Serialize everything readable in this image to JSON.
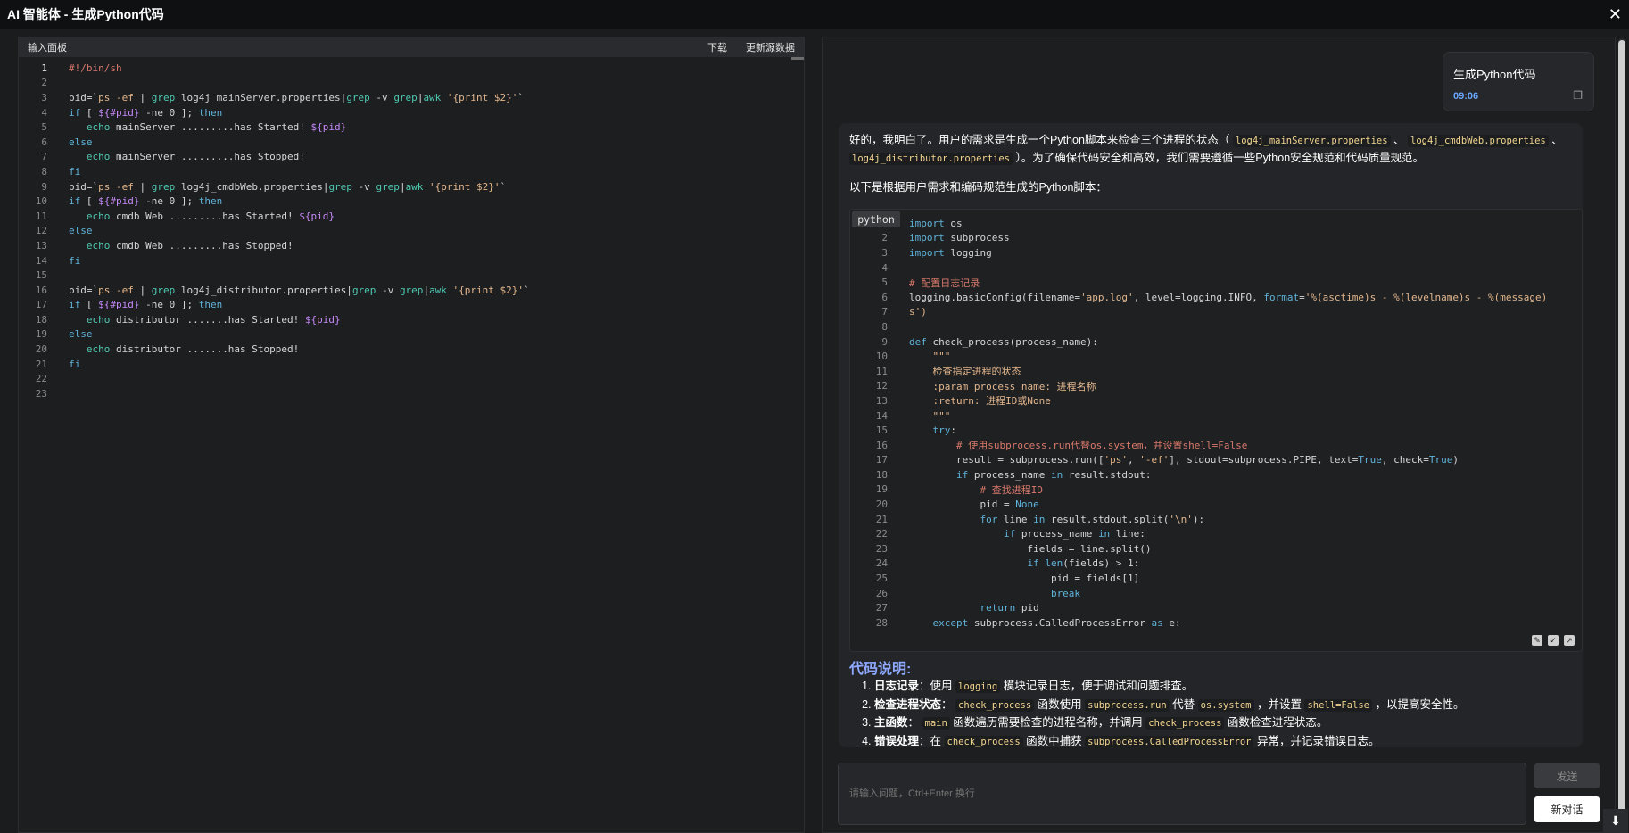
{
  "window": {
    "title": "AI 智能体 - 生成Python代码",
    "close_icon": "close-icon"
  },
  "left_panel": {
    "title": "输入面板",
    "download_label": "下载",
    "refresh_label": "更新源数据"
  },
  "shell_lines": [
    [
      {
        "t": "#!/bin/sh",
        "c": "cm"
      }
    ],
    [],
    [
      {
        "t": "pid=`",
        "c": "fl"
      },
      {
        "t": "ps -ef",
        "c": "str"
      },
      {
        "t": " | ",
        "c": "fl"
      },
      {
        "t": "grep",
        "c": "grn"
      },
      {
        "t": " log4j_mainServer.properties|",
        "c": "fl"
      },
      {
        "t": "grep",
        "c": "grn"
      },
      {
        "t": " -v ",
        "c": "fl"
      },
      {
        "t": "grep",
        "c": "grn"
      },
      {
        "t": "|",
        "c": "fl"
      },
      {
        "t": "awk",
        "c": "grn"
      },
      {
        "t": " '{print $2}'",
        "c": "str"
      },
      {
        "t": "`",
        "c": "fl"
      }
    ],
    [
      {
        "t": "if",
        "c": "kw"
      },
      {
        "t": " [ ",
        "c": "fl"
      },
      {
        "t": "${#pid}",
        "c": "var"
      },
      {
        "t": " -ne 0 ]; ",
        "c": "fl"
      },
      {
        "t": "then",
        "c": "kw"
      }
    ],
    [
      {
        "t": "   echo",
        "c": "grn"
      },
      {
        "t": " mainServer .........has Started! ",
        "c": "fl"
      },
      {
        "t": "${pid}",
        "c": "var"
      }
    ],
    [
      {
        "t": "else",
        "c": "kw"
      }
    ],
    [
      {
        "t": "   echo",
        "c": "grn"
      },
      {
        "t": " mainServer .........has Stopped!",
        "c": "fl"
      }
    ],
    [
      {
        "t": "fi",
        "c": "kw"
      }
    ],
    [
      {
        "t": "pid=`",
        "c": "fl"
      },
      {
        "t": "ps -ef",
        "c": "str"
      },
      {
        "t": " | ",
        "c": "fl"
      },
      {
        "t": "grep",
        "c": "grn"
      },
      {
        "t": " log4j_cmdbWeb.properties|",
        "c": "fl"
      },
      {
        "t": "grep",
        "c": "grn"
      },
      {
        "t": " -v ",
        "c": "fl"
      },
      {
        "t": "grep",
        "c": "grn"
      },
      {
        "t": "|",
        "c": "fl"
      },
      {
        "t": "awk",
        "c": "grn"
      },
      {
        "t": " '{print $2}'",
        "c": "str"
      },
      {
        "t": "`",
        "c": "fl"
      }
    ],
    [
      {
        "t": "if",
        "c": "kw"
      },
      {
        "t": " [ ",
        "c": "fl"
      },
      {
        "t": "${#pid}",
        "c": "var"
      },
      {
        "t": " -ne 0 ]; ",
        "c": "fl"
      },
      {
        "t": "then",
        "c": "kw"
      }
    ],
    [
      {
        "t": "   echo",
        "c": "grn"
      },
      {
        "t": " cmdb Web .........has Started! ",
        "c": "fl"
      },
      {
        "t": "${pid}",
        "c": "var"
      }
    ],
    [
      {
        "t": "else",
        "c": "kw"
      }
    ],
    [
      {
        "t": "   echo",
        "c": "grn"
      },
      {
        "t": " cmdb Web .........has Stopped!",
        "c": "fl"
      }
    ],
    [
      {
        "t": "fi",
        "c": "kw"
      }
    ],
    [],
    [
      {
        "t": "pid=`",
        "c": "fl"
      },
      {
        "t": "ps -ef",
        "c": "str"
      },
      {
        "t": " | ",
        "c": "fl"
      },
      {
        "t": "grep",
        "c": "grn"
      },
      {
        "t": " log4j_distributor.properties|",
        "c": "fl"
      },
      {
        "t": "grep",
        "c": "grn"
      },
      {
        "t": " -v ",
        "c": "fl"
      },
      {
        "t": "grep",
        "c": "grn"
      },
      {
        "t": "|",
        "c": "fl"
      },
      {
        "t": "awk",
        "c": "grn"
      },
      {
        "t": " '{print $2}'",
        "c": "str"
      },
      {
        "t": "`",
        "c": "fl"
      }
    ],
    [
      {
        "t": "if",
        "c": "kw"
      },
      {
        "t": " [ ",
        "c": "fl"
      },
      {
        "t": "${#pid}",
        "c": "var"
      },
      {
        "t": " -ne 0 ]; ",
        "c": "fl"
      },
      {
        "t": "then",
        "c": "kw"
      }
    ],
    [
      {
        "t": "   echo",
        "c": "grn"
      },
      {
        "t": " distributor .......has Started! ",
        "c": "fl"
      },
      {
        "t": "${pid}",
        "c": "var"
      }
    ],
    [
      {
        "t": "else",
        "c": "kw"
      }
    ],
    [
      {
        "t": "   echo",
        "c": "grn"
      },
      {
        "t": " distributor .......has Stopped!",
        "c": "fl"
      }
    ],
    [
      {
        "t": "fi",
        "c": "kw"
      }
    ],
    [],
    []
  ],
  "user_message": {
    "text": "生成Python代码",
    "time": "09:06",
    "copy_icon": "copy-icon"
  },
  "answer": {
    "intro_parts": [
      {
        "t": "好的，我明白了。用户的需求是生成一个Python脚本来检查三个进程的状态（ ",
        "ic": false
      },
      {
        "t": "log4j_mainServer.properties",
        "ic": true
      },
      {
        "t": " 、 ",
        "ic": false
      },
      {
        "t": "log4j_cmdbWeb.properties",
        "ic": true
      },
      {
        "t": " 、 ",
        "ic": false
      },
      {
        "t": "log4j_distributor.properties",
        "ic": true
      },
      {
        "t": " ）。为了确保代码安全和高效，我们需要遵循一些Python安全规范和代码质量规范。",
        "ic": false
      }
    ],
    "lead": "以下是根据用户需求和编码规范生成的Python脚本：",
    "lang_label": "python",
    "code_lines": [
      [
        {
          "t": "import",
          "c": "kw"
        },
        {
          "t": " os",
          "c": "fl"
        }
      ],
      [
        {
          "t": "import",
          "c": "kw"
        },
        {
          "t": " subprocess",
          "c": "fl"
        }
      ],
      [
        {
          "t": "import",
          "c": "kw"
        },
        {
          "t": " logging",
          "c": "fl"
        }
      ],
      [],
      [
        {
          "t": "# 配置日志记录",
          "c": "cm"
        }
      ],
      [
        {
          "t": "logging.basicConfig(filename=",
          "c": "fl"
        },
        {
          "t": "'app.log'",
          "c": "str"
        },
        {
          "t": ", level=logging.INFO, ",
          "c": "fl"
        },
        {
          "t": "format",
          "c": "kw"
        },
        {
          "t": "=",
          "c": "fl"
        },
        {
          "t": "'%(asctime)s - %(levelname)s - %(message)",
          "c": "str"
        }
      ],
      [
        {
          "t": "s')",
          "c": "str"
        }
      ],
      [],
      [
        {
          "t": "def",
          "c": "kw"
        },
        {
          "t": " check_process(process_name):",
          "c": "fl"
        }
      ],
      [
        {
          "t": "    \"\"\"",
          "c": "str"
        }
      ],
      [
        {
          "t": "    检查指定进程的状态",
          "c": "str"
        }
      ],
      [
        {
          "t": "    :param process_name: 进程名称",
          "c": "str"
        }
      ],
      [
        {
          "t": "    :return: 进程ID或None",
          "c": "str"
        }
      ],
      [
        {
          "t": "    \"\"\"",
          "c": "str"
        }
      ],
      [
        {
          "t": "    try",
          "c": "kw"
        },
        {
          "t": ":",
          "c": "fl"
        }
      ],
      [
        {
          "t": "        # 使用subprocess.run代替os.system，并设置shell=False",
          "c": "cm"
        }
      ],
      [
        {
          "t": "        result = subprocess.run([",
          "c": "fl"
        },
        {
          "t": "'ps'",
          "c": "str"
        },
        {
          "t": ", ",
          "c": "fl"
        },
        {
          "t": "'-ef'",
          "c": "str"
        },
        {
          "t": "], stdout=subprocess.PIPE, text=",
          "c": "fl"
        },
        {
          "t": "True",
          "c": "kw"
        },
        {
          "t": ", check=",
          "c": "fl"
        },
        {
          "t": "True",
          "c": "kw"
        },
        {
          "t": ")",
          "c": "fl"
        }
      ],
      [
        {
          "t": "        if",
          "c": "kw"
        },
        {
          "t": " process_name ",
          "c": "fl"
        },
        {
          "t": "in",
          "c": "kw"
        },
        {
          "t": " result.stdout:",
          "c": "fl"
        }
      ],
      [
        {
          "t": "            # 查找进程ID",
          "c": "cm"
        }
      ],
      [
        {
          "t": "            pid = ",
          "c": "fl"
        },
        {
          "t": "None",
          "c": "kw"
        }
      ],
      [
        {
          "t": "            for",
          "c": "kw"
        },
        {
          "t": " line ",
          "c": "fl"
        },
        {
          "t": "in",
          "c": "kw"
        },
        {
          "t": " result.stdout.split(",
          "c": "fl"
        },
        {
          "t": "'\\n'",
          "c": "str"
        },
        {
          "t": "):",
          "c": "fl"
        }
      ],
      [
        {
          "t": "                if",
          "c": "kw"
        },
        {
          "t": " process_name ",
          "c": "fl"
        },
        {
          "t": "in",
          "c": "kw"
        },
        {
          "t": " line:",
          "c": "fl"
        }
      ],
      [
        {
          "t": "                    fields = line.split()",
          "c": "fl"
        }
      ],
      [
        {
          "t": "                    if",
          "c": "kw"
        },
        {
          "t": " ",
          "c": "fl"
        },
        {
          "t": "len",
          "c": "kw"
        },
        {
          "t": "(fields) > 1:",
          "c": "fl"
        }
      ],
      [
        {
          "t": "                        pid = fields[1]",
          "c": "fl"
        }
      ],
      [
        {
          "t": "                        break",
          "c": "kw"
        }
      ],
      [
        {
          "t": "            return",
          "c": "kw"
        },
        {
          "t": " pid",
          "c": "fl"
        }
      ],
      [
        {
          "t": "    except",
          "c": "kw"
        },
        {
          "t": " subprocess.CalledProcessError ",
          "c": "fl"
        },
        {
          "t": "as",
          "c": "kw"
        },
        {
          "t": " e:",
          "c": "fl"
        }
      ]
    ],
    "code_start_line": 1,
    "section_title": "代码说明:",
    "explain_items": [
      [
        {
          "t": "日志记录",
          "b": true
        },
        {
          "t": "：使用 "
        },
        {
          "t": "logging",
          "ic": true
        },
        {
          "t": " 模块记录日志，便于调试和问题排查。"
        }
      ],
      [
        {
          "t": "检查进程状态",
          "b": true
        },
        {
          "t": "： "
        },
        {
          "t": "check_process",
          "ic": true
        },
        {
          "t": " 函数使用 "
        },
        {
          "t": "subprocess.run",
          "ic": true
        },
        {
          "t": " 代替 "
        },
        {
          "t": "os.system",
          "ic": true
        },
        {
          "t": " ，并设置 "
        },
        {
          "t": "shell=False",
          "ic": true
        },
        {
          "t": " ，以提高安全性。"
        }
      ],
      [
        {
          "t": "主函数",
          "b": true
        },
        {
          "t": "： "
        },
        {
          "t": "main",
          "ic": true
        },
        {
          "t": " 函数遍历需要检查的进程名称，并调用 "
        },
        {
          "t": "check_process",
          "ic": true
        },
        {
          "t": " 函数检查进程状态。"
        }
      ],
      [
        {
          "t": "错误处理",
          "b": true
        },
        {
          "t": "：在 "
        },
        {
          "t": "check_process",
          "ic": true
        },
        {
          "t": " 函数中捕获 "
        },
        {
          "t": "subprocess.CalledProcessError",
          "ic": true
        },
        {
          "t": " 异常，并记录错误日志。"
        }
      ]
    ]
  },
  "chat_input": {
    "placeholder": "请输入问题，Ctrl+Enter 换行",
    "send_label": "发送",
    "new_chat_label": "新对话",
    "scroll_down_icon": "arrow-down-icon"
  }
}
